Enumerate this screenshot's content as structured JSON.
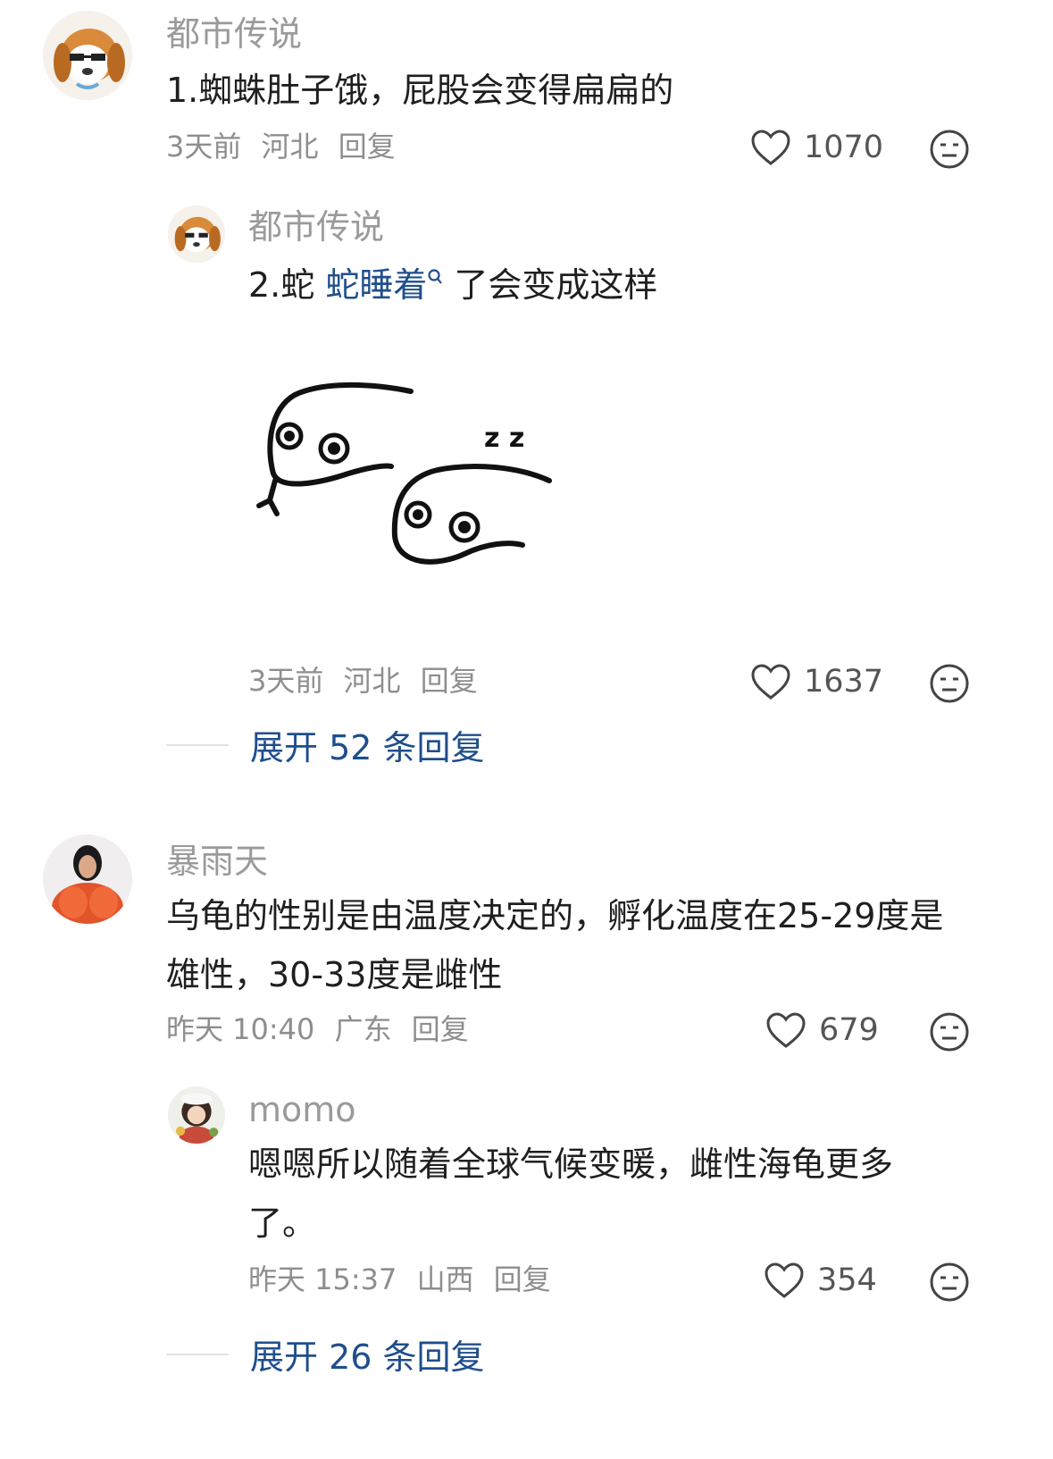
{
  "comments": [
    {
      "user": "都市传说",
      "text": "1.蜘蛛肚子饿，屁股会变得扁扁的",
      "time": "3天前",
      "location": "河北",
      "reply_label": "回复",
      "likes": "1070",
      "reply": {
        "user": "都市传说",
        "text_prefix": "2.蛇",
        "text_link": "蛇睡着",
        "text_suffix": "了会变成这样",
        "time": "3天前",
        "location": "河北",
        "reply_label": "回复",
        "likes": "1637",
        "image_text": "z z"
      },
      "expand_label": "展开 52 条回复"
    },
    {
      "user": "暴雨天",
      "text": "乌龟的性别是由温度决定的，孵化温度在25-29度是雄性，30-33度是雌性",
      "time": "昨天 10:40",
      "location": "广东",
      "reply_label": "回复",
      "likes": "679",
      "reply": {
        "user": "momo",
        "text": "嗯嗯所以随着全球气候变暖，雌性海龟更多了。",
        "time": "昨天 15:37",
        "location": "山西",
        "reply_label": "回复",
        "likes": "354"
      },
      "expand_label": "展开 26 条回复"
    }
  ],
  "colors": {
    "link": "#1f4e8c",
    "meta": "#8e8e8e",
    "username": "#9a9a9a"
  },
  "icons": [
    "heart-icon",
    "dislike-face-icon",
    "search-icon",
    "avatar-dog",
    "avatar-woman",
    "avatar-girl",
    "sleeping-snakes-sticker"
  ]
}
